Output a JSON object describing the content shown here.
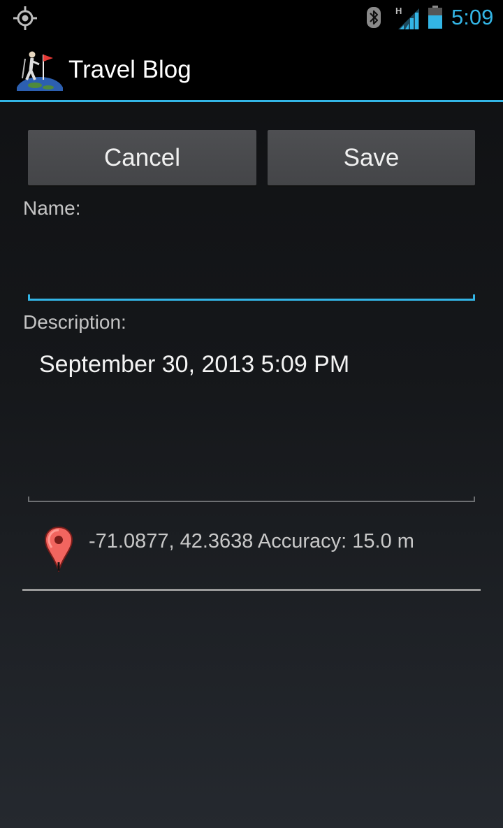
{
  "status_bar": {
    "time": "5:09",
    "network_type": "H",
    "accent_color": "#33b5e5",
    "icons": [
      "gps-icon",
      "bluetooth-icon",
      "signal-icon",
      "battery-icon"
    ]
  },
  "action_bar": {
    "title": "Travel Blog",
    "icon": "hiker-globe-icon",
    "divider_color": "#33b5e5"
  },
  "buttons": {
    "cancel_label": "Cancel",
    "save_label": "Save"
  },
  "form": {
    "name_label": "Name:",
    "name_value": "",
    "description_label": "Description:",
    "description_value": "September 30, 2013 5:09 PM"
  },
  "location": {
    "icon": "map-pin-icon",
    "text": "-71.0877, 42.3638 Accuracy: 15.0 m"
  }
}
